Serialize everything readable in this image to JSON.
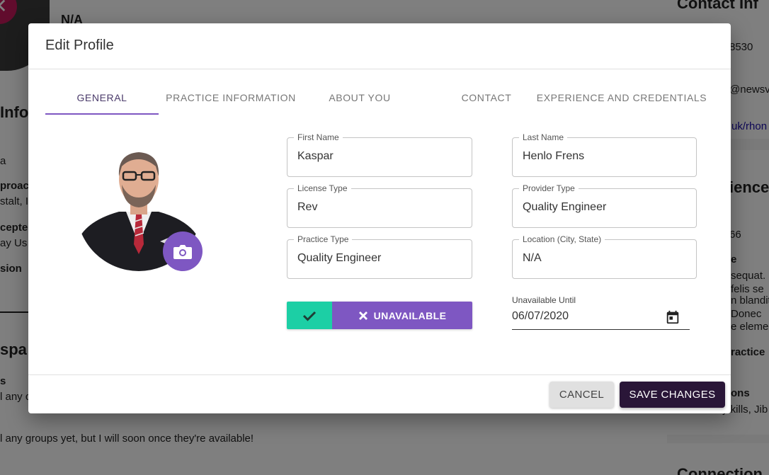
{
  "background": {
    "top_name": "N/A",
    "info_heading": "Info",
    "left_lines": [
      "a",
      "proac",
      "stalt, I",
      "cepte",
      "ay Us",
      "sion"
    ],
    "groups_heading": "spa",
    "groups_sub": "s",
    "groups_line1": "l any c",
    "groups_line2": "l any groups yet, but I will soon once they're available!",
    "right_heading": "Contact Inf",
    "right_phone": "8530",
    "right_email": "@newsv",
    "right_link": "uk/rhon",
    "right_heading2": "ience/",
    "right_num": "66",
    "right_lines": [
      "e",
      "sequat.",
      "felis se",
      "n blandit",
      "Donec",
      "e elemen"
    ],
    "right_practice": "ractice",
    "right_ons": "ons",
    "right_skills": "y kills, Jib",
    "right_heading3": "Connection"
  },
  "modal": {
    "title": "Edit Profile",
    "tabs": [
      {
        "label": "GENERAL"
      },
      {
        "label": "PRACTICE INFORMATION"
      },
      {
        "label": "ABOUT YOU"
      },
      {
        "label": "CONTACT"
      },
      {
        "label": "EXPERIENCE AND CREDENTIALS"
      }
    ],
    "fields": {
      "first_name": {
        "label": "First Name",
        "value": "Kaspar"
      },
      "last_name": {
        "label": "Last Name",
        "value": "Henlo Frens"
      },
      "license_type": {
        "label": "License Type",
        "value": "Rev"
      },
      "provider_type": {
        "label": "Provider Type",
        "value": "Quality Engineer"
      },
      "practice_type": {
        "label": "Practice Type",
        "value": "Quality Engineer"
      },
      "location": {
        "label": "Location (City, State)",
        "value": "N/A"
      }
    },
    "availability": {
      "unavailable_label": "UNAVAILABLE"
    },
    "unavailable_until": {
      "label": "Unavailable Until",
      "value": "06/07/2020"
    },
    "buttons": {
      "cancel": "CANCEL",
      "save": "SAVE CHANGES"
    }
  },
  "colors": {
    "accent": "#7e57c2",
    "available_green": "#1ccfa5",
    "save_button": "#2a1638",
    "overlay": "rgba(0,0,0,0.5)"
  },
  "icons": {
    "camera": "camera-icon",
    "check": "check-icon",
    "close": "close-icon",
    "calendar": "calendar-icon"
  }
}
